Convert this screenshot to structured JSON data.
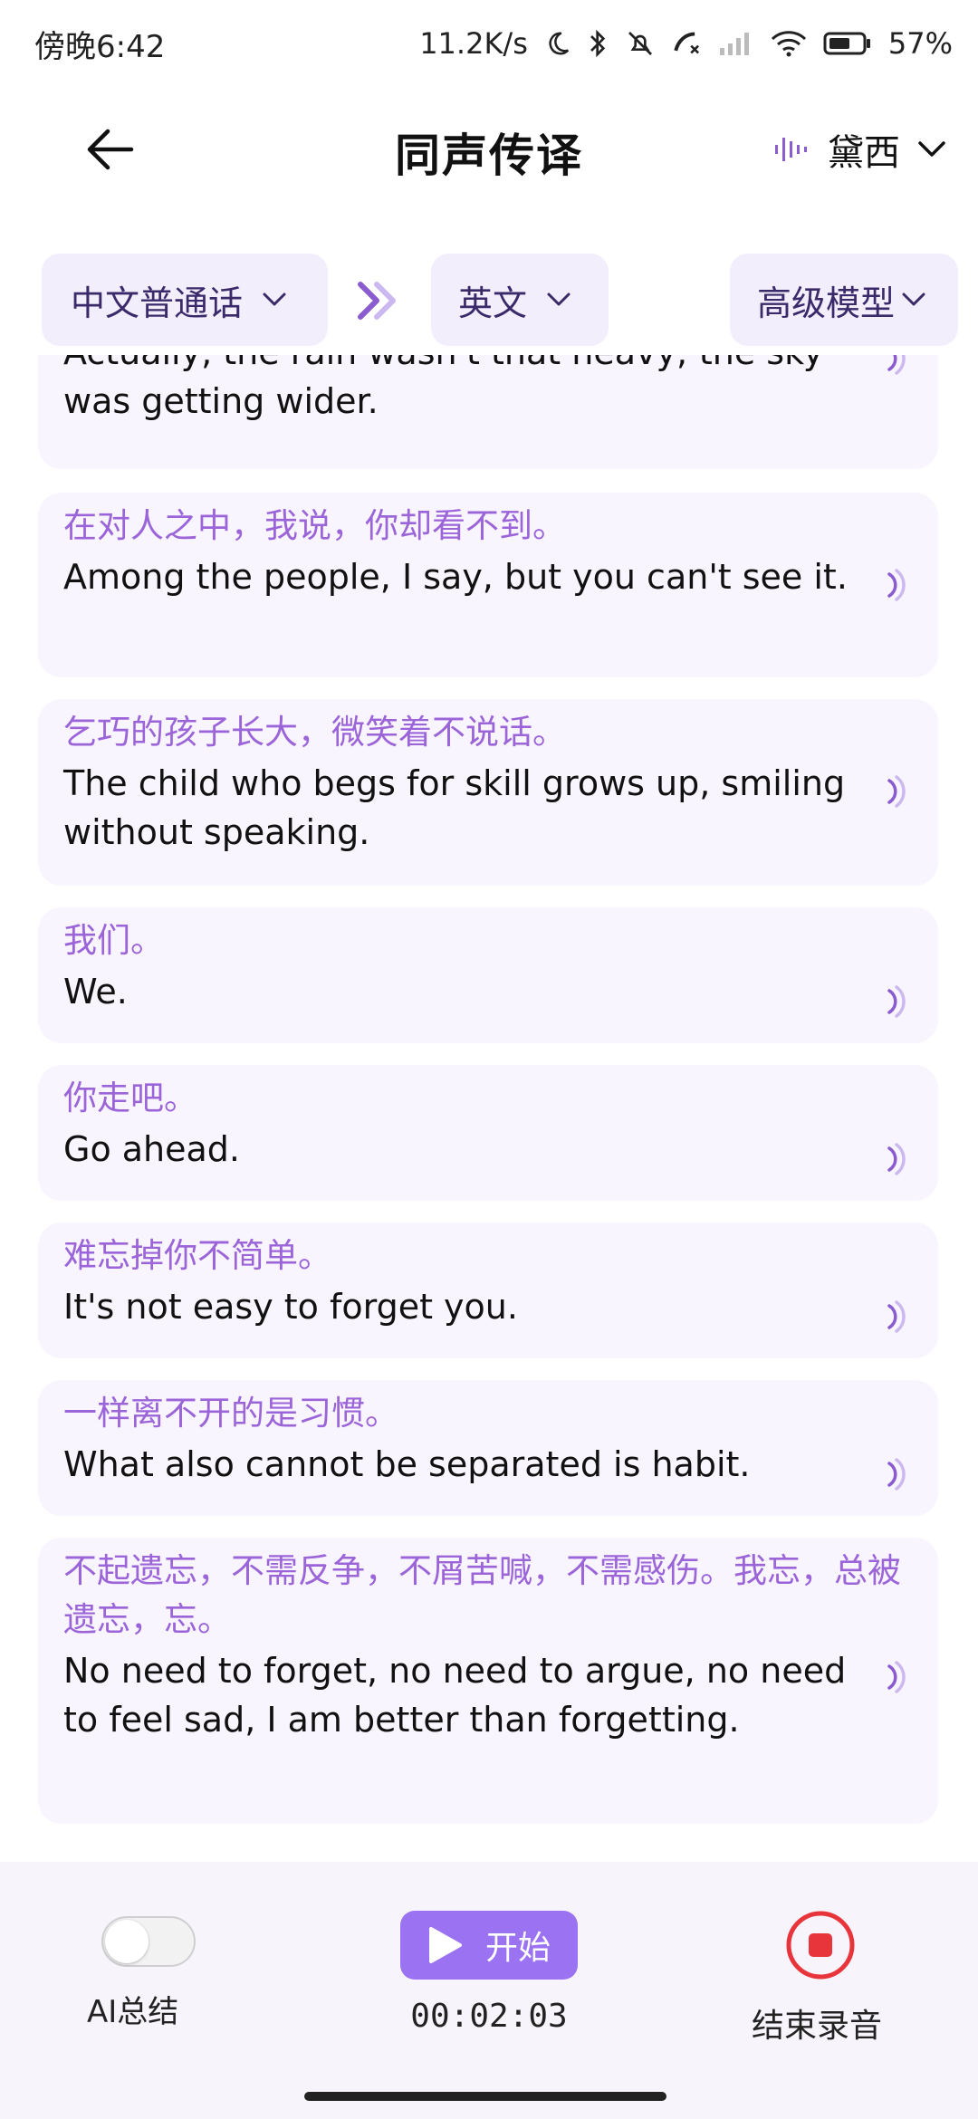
{
  "status_bar": {
    "time": "傍晚6:42",
    "net_speed": "11.2K/s",
    "battery": "57%"
  },
  "header": {
    "title": "同声传译",
    "voice": "黛西"
  },
  "lang_bar": {
    "source_lang": "中文普通话",
    "target_lang": "英文",
    "model": "高级模型"
  },
  "items": [
    {
      "src": "",
      "tgt": "Actually, the rain wasn't that heavy; the sky was getting wider."
    },
    {
      "src": "在对人之中，我说，你却看不到。",
      "tgt": "Among the people, I say, but you can't see it."
    },
    {
      "src": "乞巧的孩子长大，微笑着不说话。",
      "tgt": "The child who begs for skill grows up, smiling without speaking."
    },
    {
      "src": "我们。",
      "tgt": "We."
    },
    {
      "src": "你走吧。",
      "tgt": "Go ahead."
    },
    {
      "src": "难忘掉你不简单。",
      "tgt": "It's not easy to forget you."
    },
    {
      "src": "一样离不开的是习惯。",
      "tgt": "What also cannot be separated is habit."
    },
    {
      "src": "不起遗忘，不需反争，不屑苦喊，不需感伤。我忘，总被遗忘，忘。",
      "tgt": "No need to forget, no need to argue, no need to feel sad, I am better than forgetting."
    }
  ],
  "bottom": {
    "ai_label": "AI总结",
    "start_label": "开始",
    "timer": "00:02:03",
    "stop_label": "结束录音"
  },
  "colors": {
    "accent": "#9b73f2",
    "source_text": "#9b64d9",
    "card_bg": "#f8f5fe",
    "pill_bg": "#f3eefc",
    "stop_red": "#e8353c"
  }
}
